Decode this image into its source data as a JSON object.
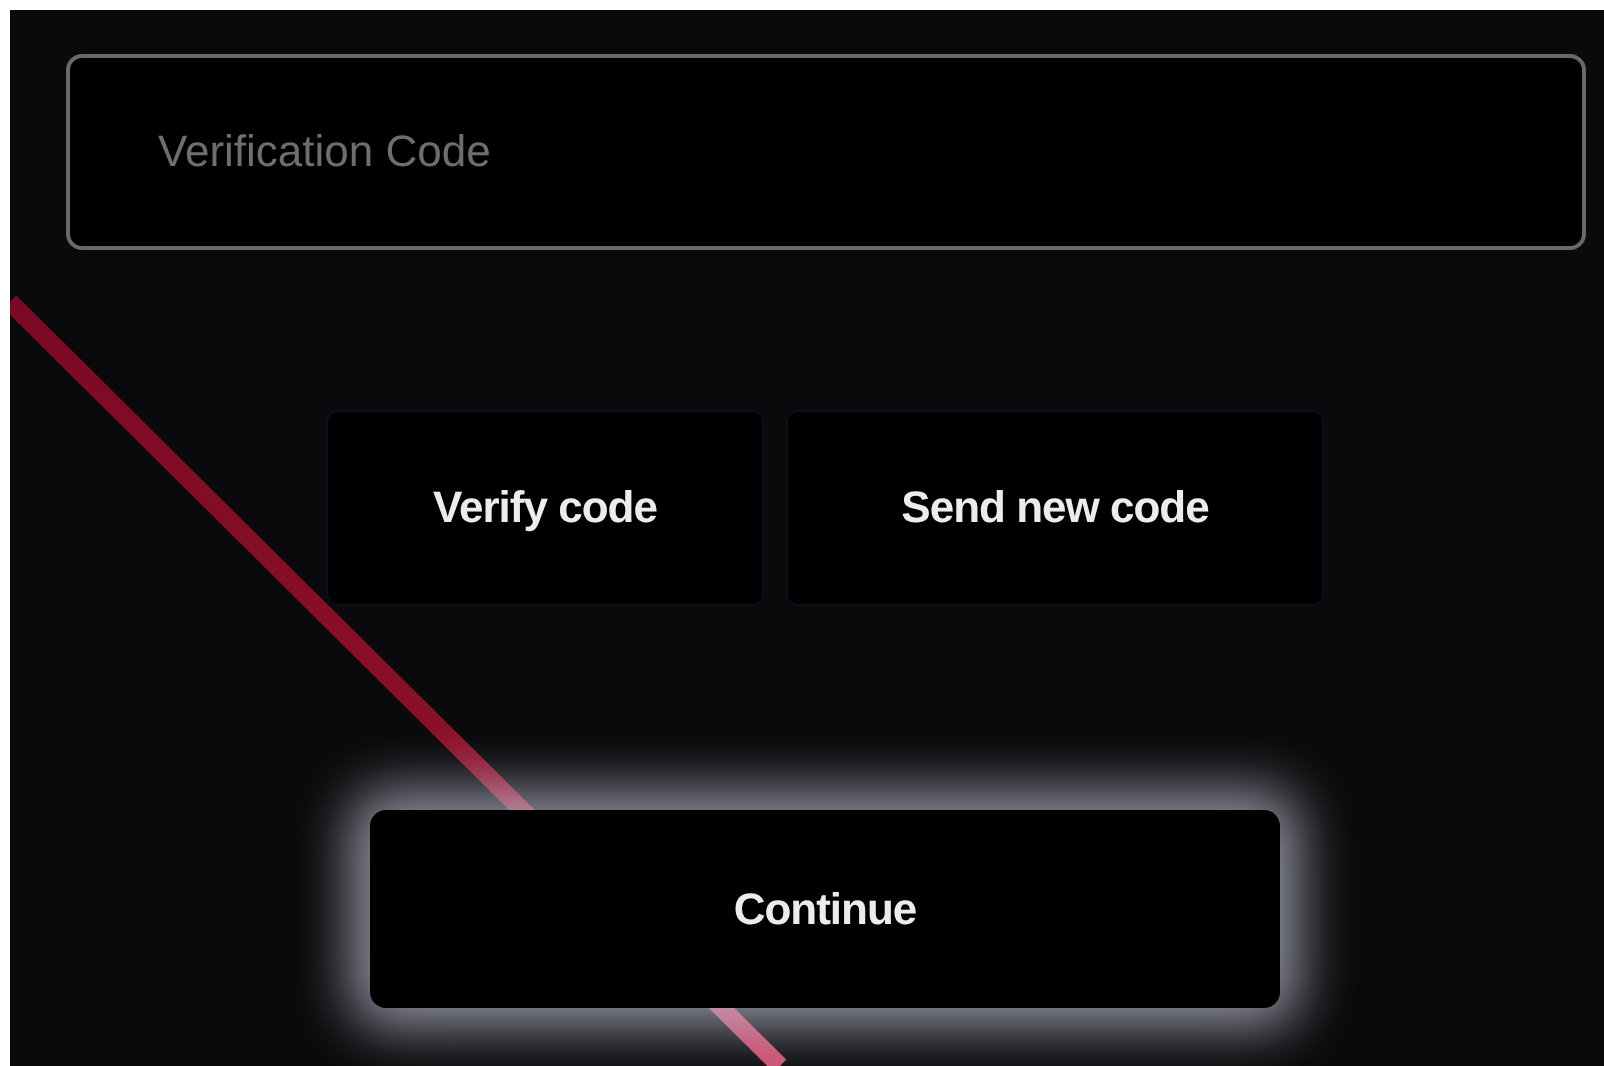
{
  "code_field": {
    "placeholder": "Verification Code"
  },
  "actions": [
    {
      "label": "Verify code"
    },
    {
      "label": "Send new code"
    }
  ],
  "continue_button": {
    "label": "Continue"
  }
}
